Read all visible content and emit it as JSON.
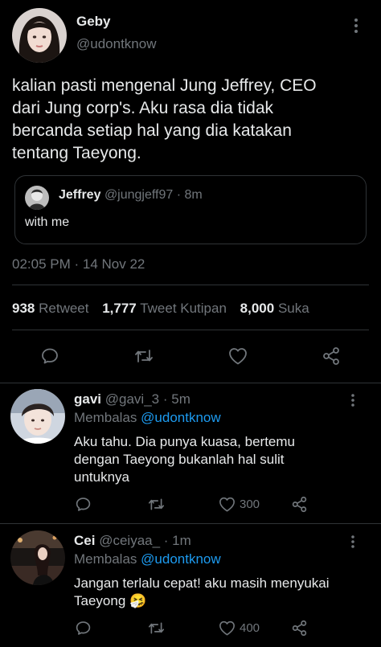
{
  "main_tweet": {
    "author_name": "Geby",
    "author_handle": "@udontknow",
    "text_lines": [
      "kalian pasti mengenal Jung Jeffrey, CEO",
      "dari Jung corp's. Aku rasa dia tidak",
      "bercanda setiap hal yang dia katakan",
      "tentang Taeyong."
    ],
    "quote": {
      "author_name": "Jeffrey",
      "author_handle": "@jungjeff97",
      "time": "· 8m",
      "text": "with me"
    },
    "timestamp": "02:05 PM · 14 Nov 22",
    "stats": {
      "retweet_count": "938",
      "retweet_label": "Retweet",
      "quote_count": "1,777",
      "quote_label": "Tweet Kutipan",
      "like_count": "8,000",
      "like_label": "Suka"
    }
  },
  "replies": [
    {
      "author_name": "gavi",
      "author_handle": "@gavi_3",
      "time": "· 5m",
      "replying_prefix": "Membalas",
      "replying_to": "@udontknow",
      "text_lines": [
        "Aku tahu. Dia punya kuasa, bertemu",
        "dengan Taeyong bukanlah hal sulit",
        "untuknya"
      ],
      "like_count": "300"
    },
    {
      "author_name": "Cei",
      "author_handle": "@ceiyaa_",
      "time": "· 1m",
      "replying_prefix": "Membalas",
      "replying_to": "@udontknow",
      "text_lines": [
        "Jangan terlalu cepat! aku masih menyukai",
        "Taeyong 🤧"
      ],
      "like_count": "400"
    }
  ],
  "colors": {
    "background": "#000000",
    "text": "#e7e9ea",
    "muted": "#71767b",
    "link": "#1d9bf0",
    "divider": "#2f3336"
  }
}
